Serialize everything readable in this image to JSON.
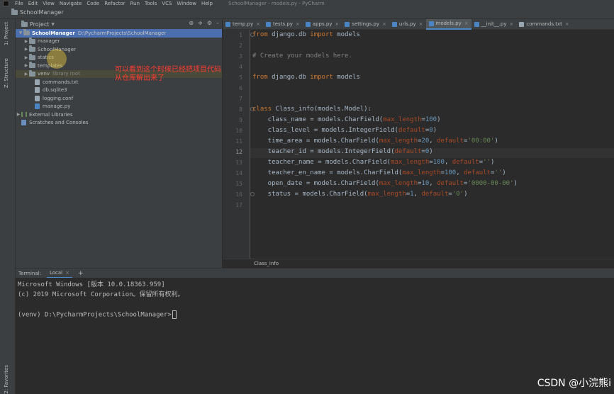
{
  "menubar": {
    "items": [
      "File",
      "Edit",
      "View",
      "Navigate",
      "Code",
      "Refactor",
      "Run",
      "Tools",
      "VCS",
      "Window",
      "Help"
    ],
    "window_title": "SchoolManager - models.py - PyCharm"
  },
  "navbar": {
    "project": "SchoolManager"
  },
  "stripe": {
    "project": "1: Project",
    "structure": "Z: Structure",
    "favorites": "2: Favorites"
  },
  "project_panel": {
    "title": "Project",
    "root": {
      "name": "SchoolManager",
      "path": "D:\\PycharmProjects\\SchoolManager"
    },
    "items": [
      {
        "name": "manager",
        "type": "folder",
        "arrow": "▶"
      },
      {
        "name": "SchoolManager",
        "type": "folder",
        "arrow": "▶"
      },
      {
        "name": "statics",
        "type": "folder",
        "arrow": "▶"
      },
      {
        "name": "templates",
        "type": "folder",
        "arrow": "▶"
      },
      {
        "name": "venv",
        "type": "folder",
        "arrow": "▶",
        "hint": "library root"
      },
      {
        "name": "commands.txt",
        "type": "file"
      },
      {
        "name": "db.sqlite3",
        "type": "file"
      },
      {
        "name": "logging.conf",
        "type": "file"
      },
      {
        "name": "manage.py",
        "type": "file"
      }
    ],
    "external_libraries": "External Libraries",
    "scratches": "Scratches and Consoles",
    "annotation_line1": "可以看到这个时候已经把项目代码",
    "annotation_line2": "从仓库解出来了"
  },
  "tabs": [
    {
      "label": "temp.py",
      "type": "py"
    },
    {
      "label": "tests.py",
      "type": "py"
    },
    {
      "label": "apps.py",
      "type": "py"
    },
    {
      "label": "settings.py",
      "type": "py"
    },
    {
      "label": "urls.py",
      "type": "py"
    },
    {
      "label": "models.py",
      "type": "py",
      "active": true
    },
    {
      "label": "__init__.py",
      "type": "py"
    },
    {
      "label": "commands.txt",
      "type": "txt"
    }
  ],
  "editor": {
    "current_line": 12,
    "line_numbers": [
      "1",
      "2",
      "3",
      "4",
      "5",
      "6",
      "7",
      "8",
      "9",
      "10",
      "11",
      "12",
      "13",
      "14",
      "15",
      "16",
      "17"
    ],
    "lines": [
      "from django.db import models",
      "",
      "# Create your models here.",
      "",
      "from django.db import models",
      "",
      "",
      "class Class_info(models.Model):",
      "    class_name = models.CharField(max_length=100)",
      "    class_level = models.IntegerField(default=0)",
      "    time_area = models.CharField(max_length=20, default='00:00')",
      "    teacher_id = models.IntegerField(default=0)",
      "    teacher_name = models.CharField(max_length=100, default='')",
      "    teacher_en_name = models.CharField(max_length=100, default='')",
      "    open_date = models.CharField(max_length=10, default='0000-00-00')",
      "    status = models.CharField(max_length=1, default='0')",
      ""
    ]
  },
  "breadcrumb": "Class_info",
  "terminal": {
    "label": "Terminal:",
    "tab": "Local",
    "add": "+",
    "lines": [
      "Microsoft Windows [版本 10.0.18363.959]",
      "(c) 2019 Microsoft Corporation。保留所有权利。",
      "",
      "(venv) D:\\PycharmProjects\\SchoolManager>"
    ]
  },
  "watermark": "CSDN @小浣熊i"
}
